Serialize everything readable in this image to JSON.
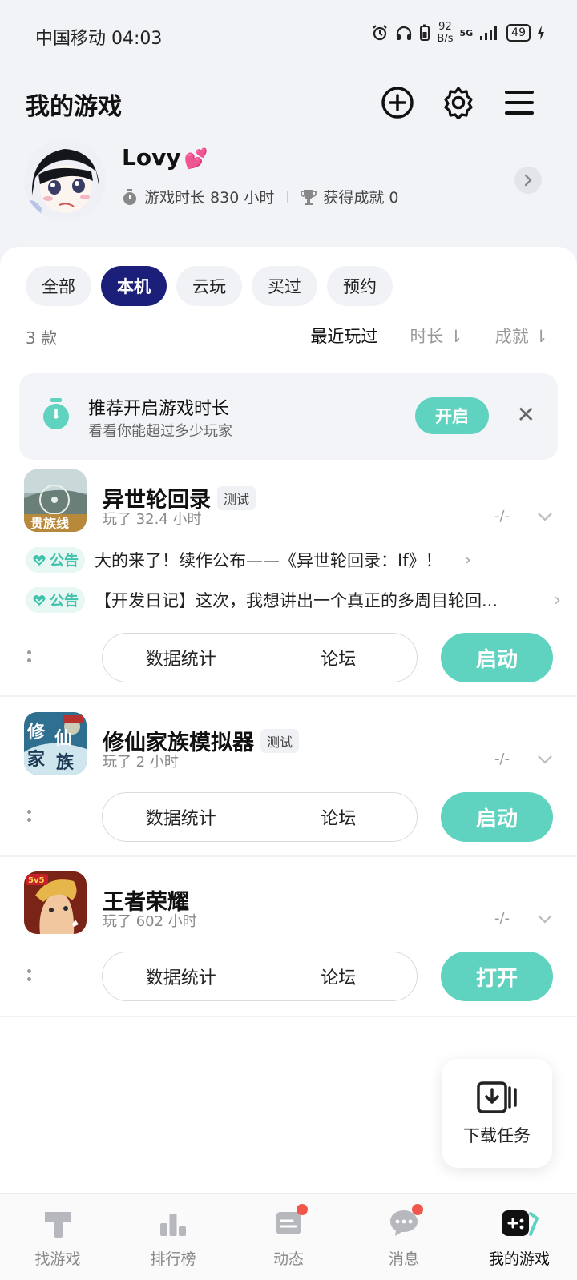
{
  "status_bar": {
    "carrier_time": "中国移动 04:03",
    "net_speed_value": "92",
    "net_speed_unit": "B/s",
    "signal_label": "5G",
    "battery": "49"
  },
  "header": {
    "title": "我的游戏"
  },
  "profile": {
    "name": "Lovy",
    "heart": "💕",
    "play_time": "游戏时长 830 小时",
    "achievements": "获得成就 0"
  },
  "filters": {
    "chips": [
      "全部",
      "本机",
      "云玩",
      "买过",
      "预约"
    ],
    "active": "本机"
  },
  "list_meta": {
    "count": "3 款",
    "sort_recent": "最近玩过",
    "sort_duration": "时长 ⇂",
    "sort_achievement": "成就 ⇂"
  },
  "tip": {
    "title": "推荐开启游戏时长",
    "subtitle": "看看你能超过多少玩家",
    "button": "开启",
    "close": "✕"
  },
  "games": [
    {
      "name": "异世轮回录",
      "tag": "测试",
      "played": "玩了 32.4 小时",
      "score": "-/-",
      "notices": [
        {
          "badge": "公告",
          "text": "大的来了！续作公布——《异世轮回录：If》！"
        },
        {
          "badge": "公告",
          "text": "【开发日记】这次，我想讲出一个真正的多周目轮回..."
        }
      ],
      "stats_label": "数据统计",
      "forum_label": "论坛",
      "action_label": "启动"
    },
    {
      "name": "修仙家族模拟器",
      "tag": "测试",
      "played": "玩了 2 小时",
      "score": "-/-",
      "notices": [],
      "stats_label": "数据统计",
      "forum_label": "论坛",
      "action_label": "启动"
    },
    {
      "name": "王者荣耀",
      "tag": "",
      "played": "玩了 602 小时",
      "score": "-/-",
      "notices": [],
      "stats_label": "数据统计",
      "forum_label": "论坛",
      "action_label": "打开"
    }
  ],
  "fab": {
    "label": "下载任务"
  },
  "bottom_nav": {
    "items": [
      {
        "label": "找游戏",
        "icon": "hammer-icon"
      },
      {
        "label": "排行榜",
        "icon": "ranking-icon"
      },
      {
        "label": "动态",
        "icon": "feed-icon"
      },
      {
        "label": "消息",
        "icon": "message-icon"
      },
      {
        "label": "我的游戏",
        "icon": "gamepad-icon"
      }
    ],
    "active": "我的游戏"
  },
  "colors": {
    "accent": "#5fd3c0",
    "active_chip": "#1b1f7a",
    "badge_dot": "#f0564a"
  }
}
